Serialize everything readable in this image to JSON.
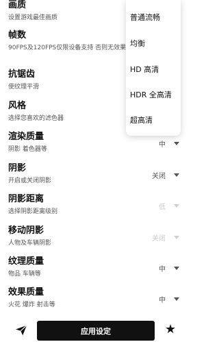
{
  "settings": [
    {
      "title": "画质",
      "desc": "设置游戏最佳画质",
      "value": ""
    },
    {
      "title": "帧数",
      "desc": "90FPS及120FPS仅限设备支持 否则无效果",
      "value": ""
    },
    {
      "title": "抗锯齿",
      "desc": "使纹理平滑",
      "value": ""
    },
    {
      "title": "风格",
      "desc": "选择您喜欢的滤色器",
      "value": ""
    },
    {
      "title": "渲染质量",
      "desc": "阴影 着色器等",
      "value": "中"
    },
    {
      "title": "阴影",
      "desc": "开启或关闭阴影",
      "value": "关闭"
    },
    {
      "title": "阴影距离",
      "desc": "选择阴影距离级别",
      "value": "低"
    },
    {
      "title": "移动阴影",
      "desc": "人物及车辆阴影",
      "value": "关闭"
    },
    {
      "title": "纹理质量",
      "desc": "物品 车辆等",
      "value": "中"
    },
    {
      "title": "效果质量",
      "desc": "火花 爆炸 射击等",
      "value": "中"
    }
  ],
  "menu": {
    "items": [
      "普通流畅",
      "均衡",
      "HD 高清",
      "HDR 全高清",
      "超高清"
    ]
  },
  "bottom": {
    "apply_label": "应用设定",
    "left_icon": "send-icon",
    "right_icon": "star-icon",
    "star_glyph": "★"
  }
}
